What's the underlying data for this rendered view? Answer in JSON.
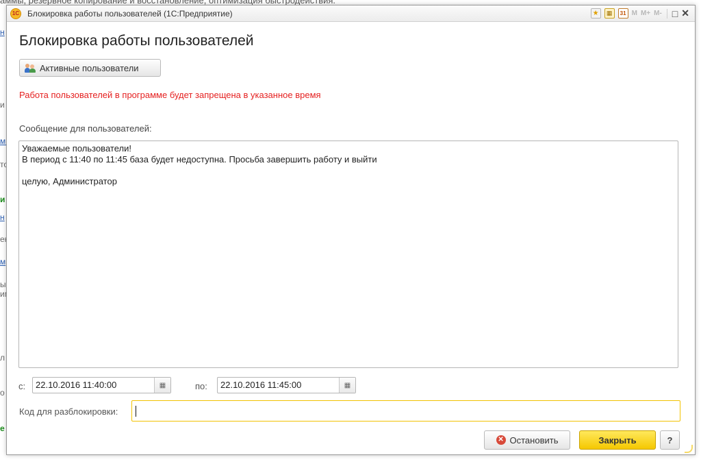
{
  "background": {
    "top_text": "аммы, резервное копирование и восстановление, оптимизация быстродействия.",
    "fragments": [
      "н",
      "и",
      "ми",
      "то",
      "и",
      "н",
      "ен",
      "м",
      "ы",
      "им",
      "л",
      "о",
      "е"
    ]
  },
  "window": {
    "logo_text": "1С",
    "title": "Блокировка работы пользователей  (1С:Предприятие)",
    "toolbar": {
      "m": "M",
      "m_plus": "M+",
      "m_minus": "M-",
      "restore_glyph": "□",
      "close_glyph": "✕",
      "calendar_day": "31"
    }
  },
  "form": {
    "heading": "Блокировка работы пользователей",
    "active_users_button": "Активные пользователи",
    "warning_text": "Работа пользователей в программе будет запрещена в указанное время",
    "message_label": "Сообщение для пользователей:",
    "message_lines": [
      "Уважаемые пользователи!",
      "В период с 11:40 по 11:45 база будет недоступна. Просьба завершить работу и выйти",
      "",
      "целую, Администратор"
    ],
    "from_label": "с:",
    "from_value": "22.10.2016 11:40:00",
    "to_label": "по:",
    "to_value": "22.10.2016 11:45:00",
    "unlock_code_label": "Код для разблокировки:",
    "unlock_code_value": ""
  },
  "buttons": {
    "stop": "Остановить",
    "close": "Закрыть",
    "help": "?"
  },
  "colors": {
    "warning": "#e52020",
    "primary_button": "#f5c800",
    "focus_border": "#f2c200"
  }
}
